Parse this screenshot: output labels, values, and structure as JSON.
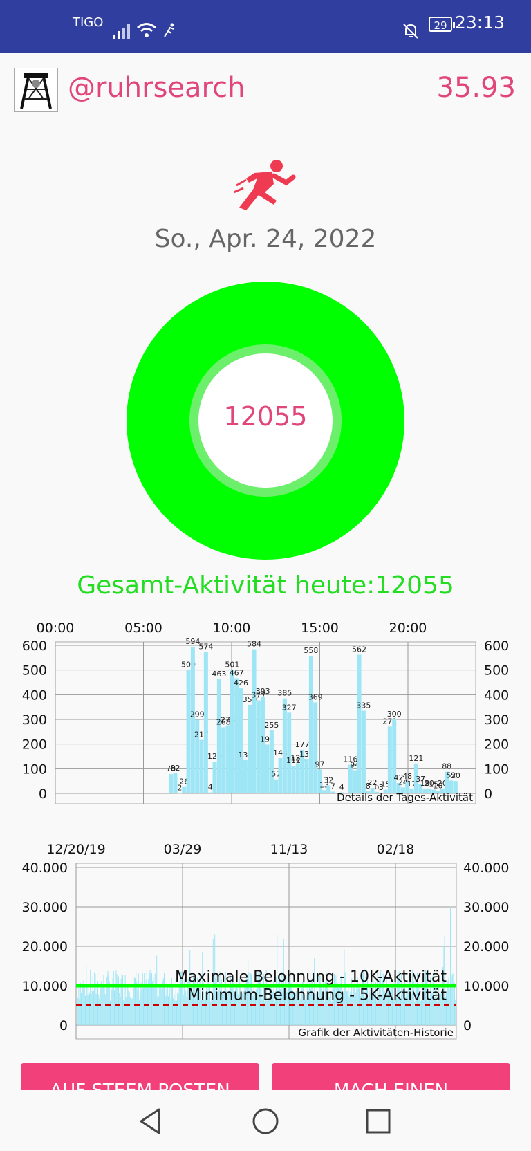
{
  "status_bar": {
    "carrier": "TIGO",
    "battery": "29",
    "time": "23:13"
  },
  "header": {
    "username": "@ruhrsearch",
    "balance": "35.93"
  },
  "activity": {
    "date": "So., Apr. 24, 2022",
    "ring_value": "12055",
    "total_label": "Gesamt-Aktivität heute:12055"
  },
  "colors": {
    "accent": "#e0457b",
    "ring_green": "#00ff00",
    "status_bar": "#303f9f",
    "bar_fill": "#9ee6f5"
  },
  "chart_data": [
    {
      "type": "bar",
      "title": "Details der Tages-Aktivität",
      "x_ticks": [
        "00:00",
        "05:00",
        "10:00",
        "15:00",
        "20:00"
      ],
      "y_ticks": [
        "600",
        "500",
        "400",
        "300",
        "200",
        "100",
        "0"
      ],
      "ylim": [
        0,
        650
      ],
      "grid": true,
      "bars": [
        {
          "hour": 6.6,
          "v": 78
        },
        {
          "hour": 6.85,
          "v": 82
        },
        {
          "hour": 7.1,
          "v": 2
        },
        {
          "hour": 7.35,
          "v": 26
        },
        {
          "hour": 7.6,
          "v": 500
        },
        {
          "hour": 7.85,
          "v": 594
        },
        {
          "hour": 8.1,
          "v": 299
        },
        {
          "hour": 8.35,
          "v": 217
        },
        {
          "hour": 8.6,
          "v": 574
        },
        {
          "hour": 8.85,
          "v": 4
        },
        {
          "hour": 9.1,
          "v": 129
        },
        {
          "hour": 9.35,
          "v": 463
        },
        {
          "hour": 9.6,
          "v": 268
        },
        {
          "hour": 9.85,
          "v": 276
        },
        {
          "hour": 10.1,
          "v": 501
        },
        {
          "hour": 10.35,
          "v": 467
        },
        {
          "hour": 10.6,
          "v": 426
        },
        {
          "hour": 10.85,
          "v": 135
        },
        {
          "hour": 11.1,
          "v": 359
        },
        {
          "hour": 11.35,
          "v": 584
        },
        {
          "hour": 11.6,
          "v": 377
        },
        {
          "hour": 11.85,
          "v": 393
        },
        {
          "hour": 12.1,
          "v": 197
        },
        {
          "hour": 12.35,
          "v": 255
        },
        {
          "hour": 12.6,
          "v": 57
        },
        {
          "hour": 12.85,
          "v": 143
        },
        {
          "hour": 13.1,
          "v": 385
        },
        {
          "hour": 13.35,
          "v": 327
        },
        {
          "hour": 13.6,
          "v": 112
        },
        {
          "hour": 13.85,
          "v": 122
        },
        {
          "hour": 14.1,
          "v": 177
        },
        {
          "hour": 14.35,
          "v": 138
        },
        {
          "hour": 14.6,
          "v": 558
        },
        {
          "hour": 14.85,
          "v": 369
        },
        {
          "hour": 15.1,
          "v": 97
        },
        {
          "hour": 15.35,
          "v": 13
        },
        {
          "hour": 15.6,
          "v": 32
        },
        {
          "hour": 15.85,
          "v": 7
        },
        {
          "hour": 16.35,
          "v": 4
        },
        {
          "hour": 16.85,
          "v": 116
        },
        {
          "hour": 17.1,
          "v": 94
        },
        {
          "hour": 17.35,
          "v": 562
        },
        {
          "hour": 17.6,
          "v": 335
        },
        {
          "hour": 17.85,
          "v": 8
        },
        {
          "hour": 18.1,
          "v": 22
        },
        {
          "hour": 18.35,
          "v": 6
        },
        {
          "hour": 18.6,
          "v": 3
        },
        {
          "hour": 18.85,
          "v": 15
        },
        {
          "hour": 19.1,
          "v": 271
        },
        {
          "hour": 19.35,
          "v": 300
        },
        {
          "hour": 19.6,
          "v": 42
        },
        {
          "hour": 19.85,
          "v": 24
        },
        {
          "hour": 20.1,
          "v": 48
        },
        {
          "hour": 20.35,
          "v": 17
        },
        {
          "hour": 20.6,
          "v": 121
        },
        {
          "hour": 20.85,
          "v": 37
        },
        {
          "hour": 21.1,
          "v": 19
        },
        {
          "hour": 21.35,
          "v": 20
        },
        {
          "hour": 21.6,
          "v": 15
        },
        {
          "hour": 21.85,
          "v": 10
        },
        {
          "hour": 22.1,
          "v": 20
        },
        {
          "hour": 22.35,
          "v": 88
        },
        {
          "hour": 22.6,
          "v": 52
        },
        {
          "hour": 22.85,
          "v": 50
        }
      ]
    },
    {
      "type": "bar",
      "title": "Grafik der Aktivitäten-Historie",
      "x_ticks": [
        "12/20/19",
        "03/29",
        "11/13",
        "02/18"
      ],
      "y_ticks": [
        "40.000",
        "30.000",
        "20.000",
        "10.000",
        "0"
      ],
      "ylim": [
        0,
        40000
      ],
      "grid": true,
      "reference_lines": [
        {
          "label": "Maximale Belohnung - 10K-Aktivität",
          "value": 10000,
          "color": "#00ff00",
          "style": "solid"
        },
        {
          "label": "Minimum-Belohnung - 5K-Aktivität",
          "value": 5000,
          "color": "#cc0000",
          "style": "dashed"
        }
      ],
      "notes": "dense daily history series (~870 bars), mostly between 5.000 and 16.000 with peaks up to ~37.000"
    }
  ],
  "buttons": {
    "post_label": "AUF STEEM POSTEN",
    "challenge_label": "MACH EINEN"
  }
}
